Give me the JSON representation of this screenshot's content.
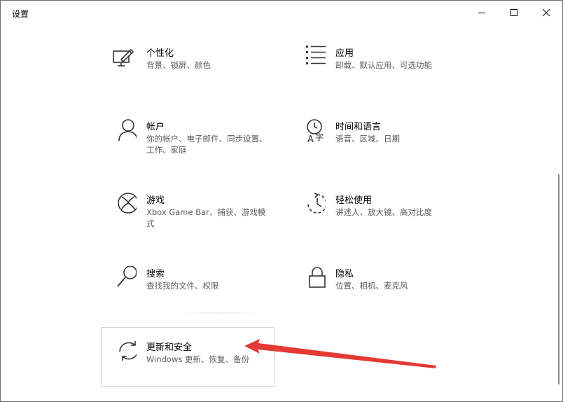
{
  "window": {
    "title": "设置"
  },
  "items": [
    {
      "name": "个性化",
      "desc": "背景、锁屏、颜色",
      "icon": "personalization-icon"
    },
    {
      "name": "应用",
      "desc": "卸载、默认应用、可选功能",
      "icon": "apps-icon"
    },
    {
      "name": "帐户",
      "desc": "你的帐户、电子邮件、同步设置、工作、家庭",
      "icon": "accounts-icon"
    },
    {
      "name": "时间和语言",
      "desc": "语音、区域、日期",
      "icon": "time-language-icon"
    },
    {
      "name": "游戏",
      "desc": "Xbox Game Bar、捕获、游戏模式",
      "icon": "xbox-icon"
    },
    {
      "name": "轻松使用",
      "desc": "讲述人、放大镜、高对比度",
      "icon": "ease-of-access-icon"
    },
    {
      "name": "搜索",
      "desc": "查找我的文件、权限",
      "icon": "search-icon"
    },
    {
      "name": "隐私",
      "desc": "位置、相机、麦克风",
      "icon": "lock-icon"
    },
    {
      "name": "更新和安全",
      "desc": "Windows 更新、恢复、备份",
      "icon": "update-icon"
    }
  ],
  "colors": {
    "annotation_arrow": "#e53935",
    "selected_border": "#d6d6d6"
  }
}
